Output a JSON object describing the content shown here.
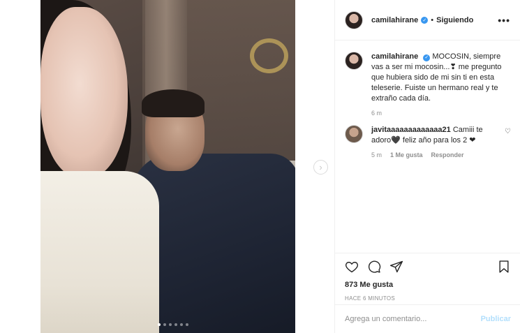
{
  "post": {
    "username": "camilahirane",
    "separator": "•",
    "following_label": "Siguiendo",
    "more_icon": "more-options-icon",
    "caption": "MOCOSIN, siempre vas a ser mi mocosin...❣ me pregunto que hubiera sido de mi sin ti en esta teleserie. Fuiste un hermano real y te extraño cada día.",
    "caption_time": "6 m",
    "likes": "873 Me gusta",
    "date": "HACE 6 MINUTOS"
  },
  "comments": [
    {
      "username": "javitaaaaaaaaaaaaa21",
      "text": "Camiii te adoro🖤 feliz año para los 2 ❤",
      "time": "5 m",
      "likes": "1 Me gusta",
      "reply": "Responder"
    }
  ],
  "composer": {
    "placeholder": "Agrega un comentario...",
    "publish_label": "Publicar"
  },
  "carousel": {
    "slide_count": 6,
    "active_slide": 1
  },
  "colors": {
    "verified": "#3897f0",
    "publish_disabled": "#b2dffc",
    "muted_text": "#8e8e8e",
    "border": "#efefef"
  }
}
